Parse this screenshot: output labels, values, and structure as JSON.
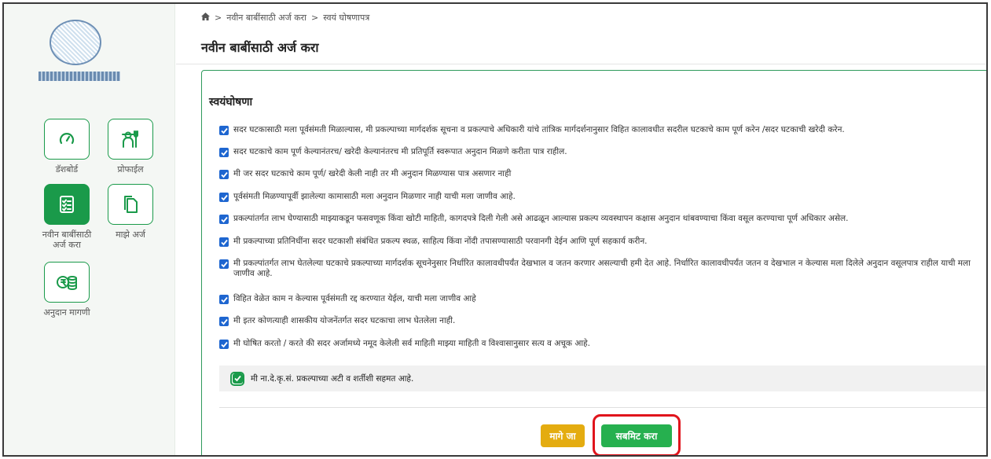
{
  "breadcrumb": {
    "items": [
      "नवीन बाबींसाठी अर्ज करा",
      "स्वयं घोषणापत्र"
    ]
  },
  "page": {
    "title": "नवीन बाबींसाठी अर्ज करा"
  },
  "sidebar": {
    "items": [
      {
        "label": "डॅशबोर्ड",
        "icon": "gauge-icon"
      },
      {
        "label": "प्रोफाईल",
        "icon": "farmer-icon"
      },
      {
        "label": "नवीन बाबींसाठी अर्ज करा",
        "icon": "checklist-icon",
        "active": true
      },
      {
        "label": "माझे अर्ज",
        "icon": "documents-icon"
      },
      {
        "label": "अनुदान मागणी",
        "icon": "money-coins-icon"
      }
    ]
  },
  "declaration": {
    "title": "स्वयंघोषणा",
    "items": [
      "सदर घटकासाठी मला पूर्वसंमती मिळाल्यास, मी प्रकल्पाच्या मार्गदर्शक सूचना व प्रकल्पाचे अधिकारी यांचे तांत्रिक मार्गदर्शनानुसार विहित कालावधीत सदरील घटकाचे काम पूर्ण करेन /सदर घटकाची खरेदी करेन.",
      "सदर घटकाचे काम पूर्ण केल्यानंतरच/ खरेदी केल्यानंतरच मी प्रतिपूर्ति स्वरूपात अनुदान मिळणे करीता पात्र राहील.",
      "मी जर सदर घटकाचे काम पूर्ण/ खरेदी केली नाही तर मी अनुदान मिळण्यास पात्र असणार नाही",
      "पूर्वसंमती मिळण्यापूर्वी झालेल्या कामासाठी मला अनुदान मिळणार नाही याची मला जाणीव आहे.",
      "प्रकल्पांतर्गत लाभ घेण्यासाठी माझ्याकडून फसवणूक किंवा खोटी माहिती, कागदपत्रे दिली गेली असे आढळून आल्यास प्रकल्प व्यवस्थापन कक्षास अनुदान थांबवण्याचा किंवा वसूल करण्याचा पूर्ण अधिकार असेल.",
      "मी प्रकल्पाच्या प्रतिनिधींना सदर घटकाशी संबंधित प्रकल्प स्थळ, साहित्य किंवा नोंदी तपासण्यासाठी परवानगी देईन आणि पूर्ण सहकार्य करीन.",
      "मी प्रकल्पांतर्गत लाभ घेतलेल्या घटकाचे प्रकल्पाच्या मार्गदर्शक सूचनेनुसार निर्धारित कालावधीपर्यंत देखभाल व जतन करणार असल्याची हमी देत आहे. निर्धारित कालावधीपर्यंत जतन व देखभाल न केल्यास मला दिलेले अनुदान वसूलपात्र राहील याची मला जाणीव आहे.",
      "विहित वेळेत काम न केल्यास पूर्वसंमती रद्द करण्यात येईल, याची मला जाणीव आहे",
      "मी इतर कोणत्याही शासकीय योजनेंतर्गत सदर घटकाचा लाभ घेतलेला नाही.",
      "मी घोषित करतो / करते की सदर अर्जामध्ये नमूद केलेली सर्व माहिती माझ्या माहिती व विश्वासानुसार सत्य व अचूक आहे."
    ],
    "agree_label": "मी ना.दे.कृ.सं. प्रकल्पाच्या अटी व शर्तीशी सहमत आहे."
  },
  "buttons": {
    "back_label": "मागे जा",
    "submit_label": "सबमिट करा"
  },
  "colors": {
    "accent_green": "#1a9a4a",
    "checkbox_blue": "#1e66d0",
    "back_button": "#e4ac10",
    "submit_button": "#26b04f",
    "highlight_red": "#e0141c"
  }
}
